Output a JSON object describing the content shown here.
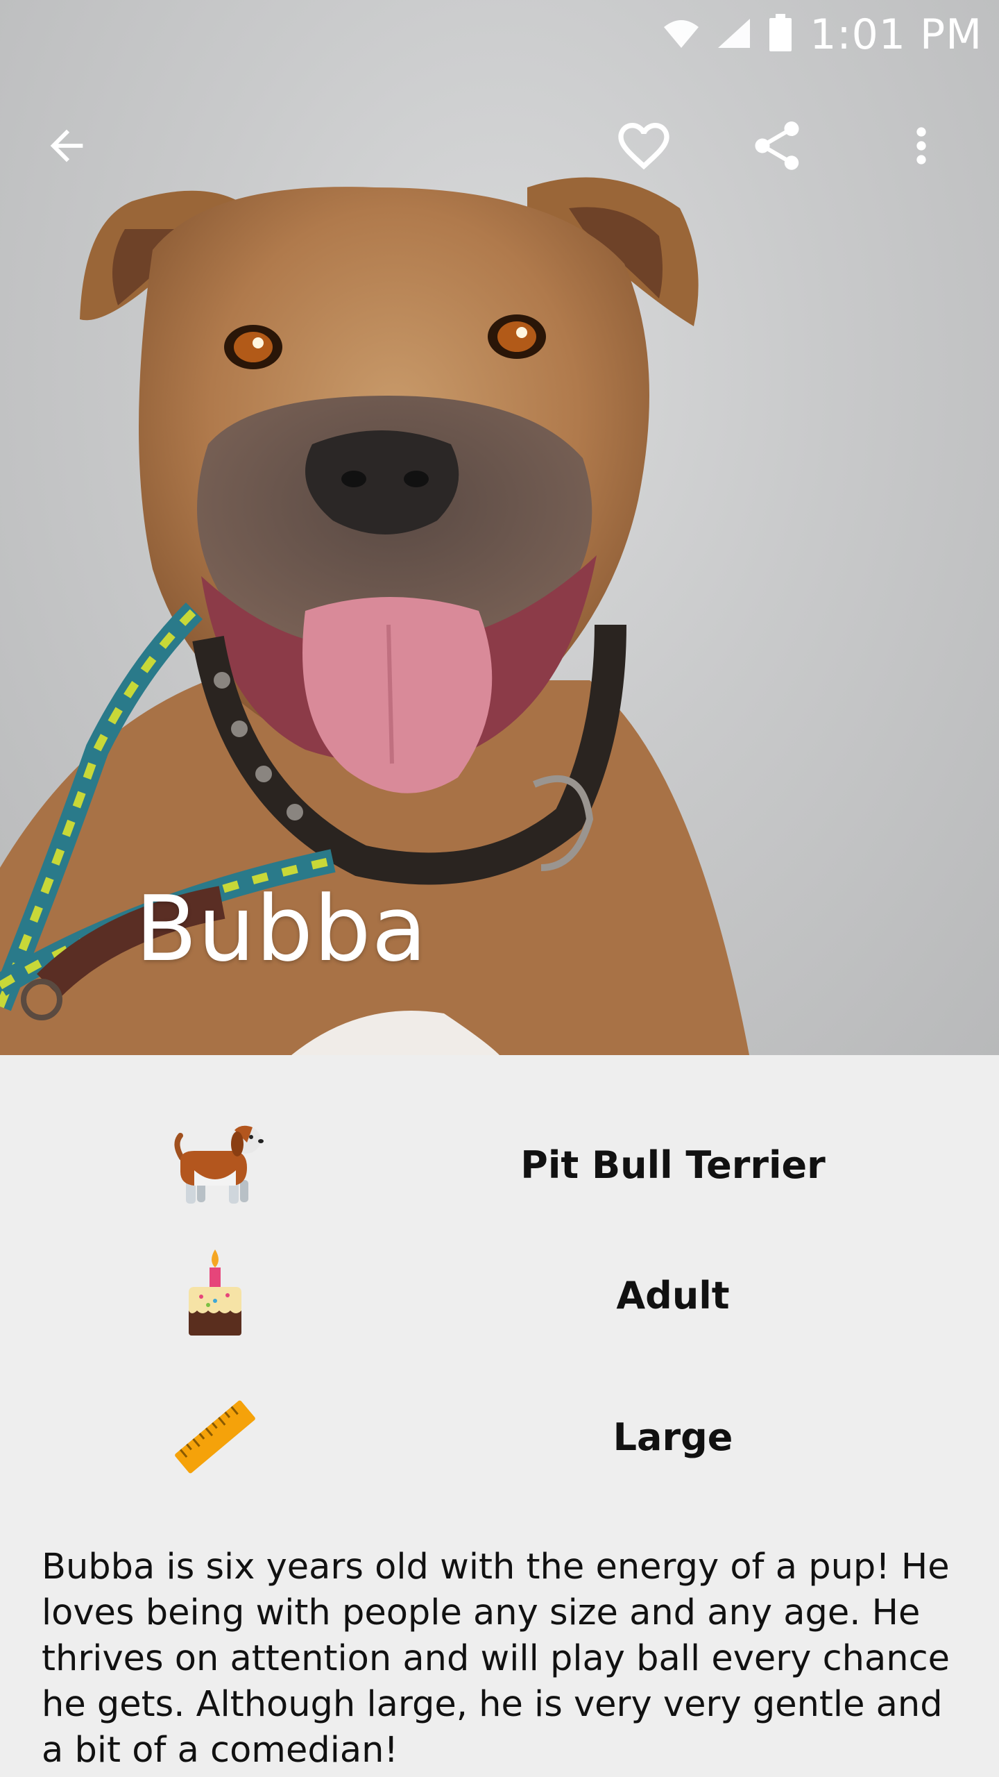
{
  "status_bar": {
    "time": "1:01 PM",
    "icons": [
      "wifi-icon",
      "cell-signal-icon",
      "battery-icon"
    ]
  },
  "toolbar": {
    "back": "back-arrow-icon",
    "favorite": "heart-outline-icon",
    "share": "share-icon",
    "more": "more-vert-icon"
  },
  "pet": {
    "name": "Bubba",
    "breed": "Pit Bull Terrier",
    "age": "Adult",
    "size": "Large",
    "description": "Bubba is six years old with the energy of a pup!  He loves being with people any size and any age.  He thrives on attention and will play ball every chance he gets.  Although large, he is very very gentle and a bit of a comedian!"
  },
  "detail_icons": {
    "breed": "dog-icon",
    "age": "birthday-cake-icon",
    "size": "ruler-icon"
  },
  "colors": {
    "background": "#eeeeee",
    "text": "#111111",
    "overlay_text": "#ffffff"
  }
}
